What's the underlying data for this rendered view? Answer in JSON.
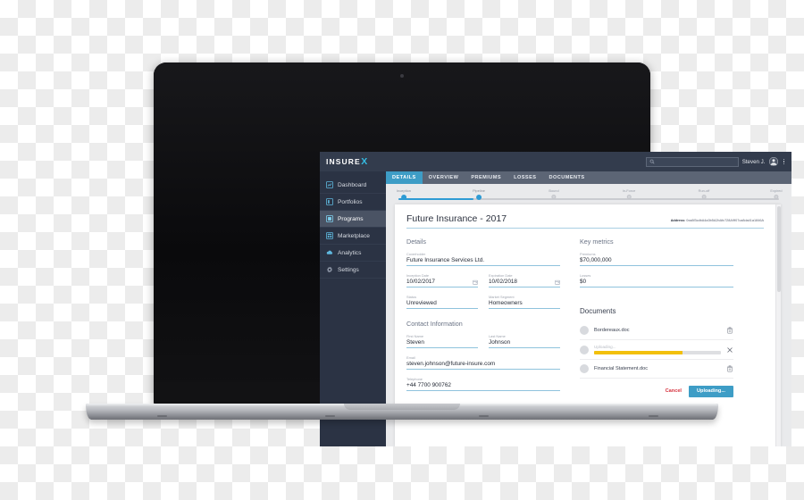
{
  "app": {
    "logo_main": "INSURE",
    "logo_accent": "X",
    "accent_color": "#3e9dc6",
    "sidebar_color": "#2b3344",
    "topbar_color": "#333c4d"
  },
  "topbar": {
    "search_placeholder": "",
    "search_icon": "search-icon",
    "user_name": "Steven J.",
    "avatar_icon": "user-avatar-icon",
    "menu_icon": "kebab-menu-icon"
  },
  "sidebar": {
    "items": [
      {
        "label": "Dashboard",
        "icon": "chart-icon",
        "active": false
      },
      {
        "label": "Portfolios",
        "icon": "folder-icon",
        "active": false
      },
      {
        "label": "Programs",
        "icon": "square-icon",
        "active": true
      },
      {
        "label": "Marketplace",
        "icon": "storefront-icon",
        "active": false
      },
      {
        "label": "Analytics",
        "icon": "cloud-icon",
        "active": false
      },
      {
        "label": "Settings",
        "icon": "gear-icon",
        "active": false
      }
    ]
  },
  "tabs": [
    {
      "label": "DETAILS",
      "active": true
    },
    {
      "label": "OVERVIEW",
      "active": false
    },
    {
      "label": "PREMIUMS",
      "active": false
    },
    {
      "label": "LOSSES",
      "active": false
    },
    {
      "label": "DOCUMENTS",
      "active": false
    }
  ],
  "stepper": {
    "steps": [
      {
        "label": "Inception",
        "done": true
      },
      {
        "label": "Pipeline",
        "done": true
      },
      {
        "label": "Bound",
        "done": false
      },
      {
        "label": "In-Force",
        "done": false
      },
      {
        "label": "Run-off",
        "done": false
      },
      {
        "label": "Expired",
        "done": false
      }
    ],
    "current": "Pipeline",
    "fill_color": "#2e9bd4"
  },
  "card": {
    "title": "Future Insurance - 2017",
    "address_label": "Address:",
    "address_value": "0xa8f3cdbA4a3b5A2bAfc728A9f07ca8da41a1846A"
  },
  "details": {
    "heading": "Details",
    "coverholder": {
      "label": "Coverholder",
      "value": "Future Insurance Services Ltd."
    },
    "inception_date": {
      "label": "Inception Date",
      "value": "10/02/2017",
      "icon": "calendar-icon"
    },
    "expiration_date": {
      "label": "Expiration Date",
      "value": "10/02/2018",
      "icon": "calendar-icon"
    },
    "status": {
      "label": "Status",
      "value": "Unreviewed"
    },
    "market_segment": {
      "label": "Market Segment",
      "value": "Homeowners"
    }
  },
  "contact": {
    "heading": "Contact Information",
    "first_name": {
      "label": "First Name",
      "value": "Steven"
    },
    "last_name": {
      "label": "Last Name",
      "value": "Johnson"
    },
    "email": {
      "label": "Email",
      "value": "steven.johnson@future-insure.com"
    },
    "telephone": {
      "label": "Telephone",
      "value": "+44 7700 900762"
    }
  },
  "key_metrics": {
    "heading": "Key metrics",
    "premiums": {
      "label": "Premiums",
      "value": "$70,000,000"
    },
    "losses": {
      "label": "Losses",
      "value": "$0"
    }
  },
  "documents": {
    "heading": "Documents",
    "items": [
      {
        "name": "Bordereaux.doc",
        "state": "done",
        "action_icon": "trash-icon"
      },
      {
        "name": "Uploading...",
        "state": "uploading",
        "progress": 70,
        "progress_color": "#f2c00c",
        "action_icon": "close-icon"
      },
      {
        "name": "Financial Statement.doc",
        "state": "done",
        "action_icon": "trash-icon"
      }
    ],
    "cancel_label": "Cancel",
    "upload_label": "Uploading...",
    "cancel_color": "#d6333f"
  }
}
